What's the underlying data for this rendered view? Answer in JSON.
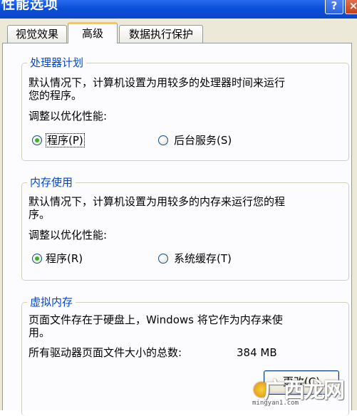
{
  "window": {
    "title": "性能选项",
    "help_glyph": "?",
    "close_glyph": "×"
  },
  "tabs": [
    {
      "label": "视觉效果",
      "active": false
    },
    {
      "label": "高级",
      "active": true
    },
    {
      "label": "数据执行保护",
      "active": false
    }
  ],
  "processor": {
    "title": "处理器计划",
    "desc_line1": "默认情况下，计算机设置为用较多的处理器时间来运行",
    "desc_line2": "您的程序。",
    "adjust_label": "调整以优化性能:",
    "option_programs": {
      "label_main": "程序",
      "label_key": "(P)",
      "checked": true
    },
    "option_services": {
      "label_main": "后台服务",
      "label_key": "(S)",
      "checked": false
    }
  },
  "memory": {
    "title": "内存使用",
    "desc_line1": "默认情况下，计算机设置为用较多的内存来运行您的程",
    "desc_line2": "序。",
    "adjust_label": "调整以优化性能:",
    "option_programs": {
      "label_main": "程序",
      "label_key": "(R)",
      "checked": true
    },
    "option_cache": {
      "label_main": "系统缓存",
      "label_key": "(T)",
      "checked": false
    }
  },
  "virtual_memory": {
    "title": "虚拟内存",
    "desc_line1": "页面文件存在于硬盘上，Windows 将它作为内存来使",
    "desc_line2": "用。",
    "total_label": "所有驱动器页面文件大小的总数:",
    "total_value": "384 MB",
    "change_button": "更改(C)"
  },
  "watermark": {
    "text": "广西龙网",
    "url": "mingyan1.com"
  },
  "colors": {
    "titlebar": "#0a4fd8",
    "group_title": "#0046d5",
    "tab_highlight": "#ffc83c",
    "radio_dot": "#3fb02d"
  }
}
